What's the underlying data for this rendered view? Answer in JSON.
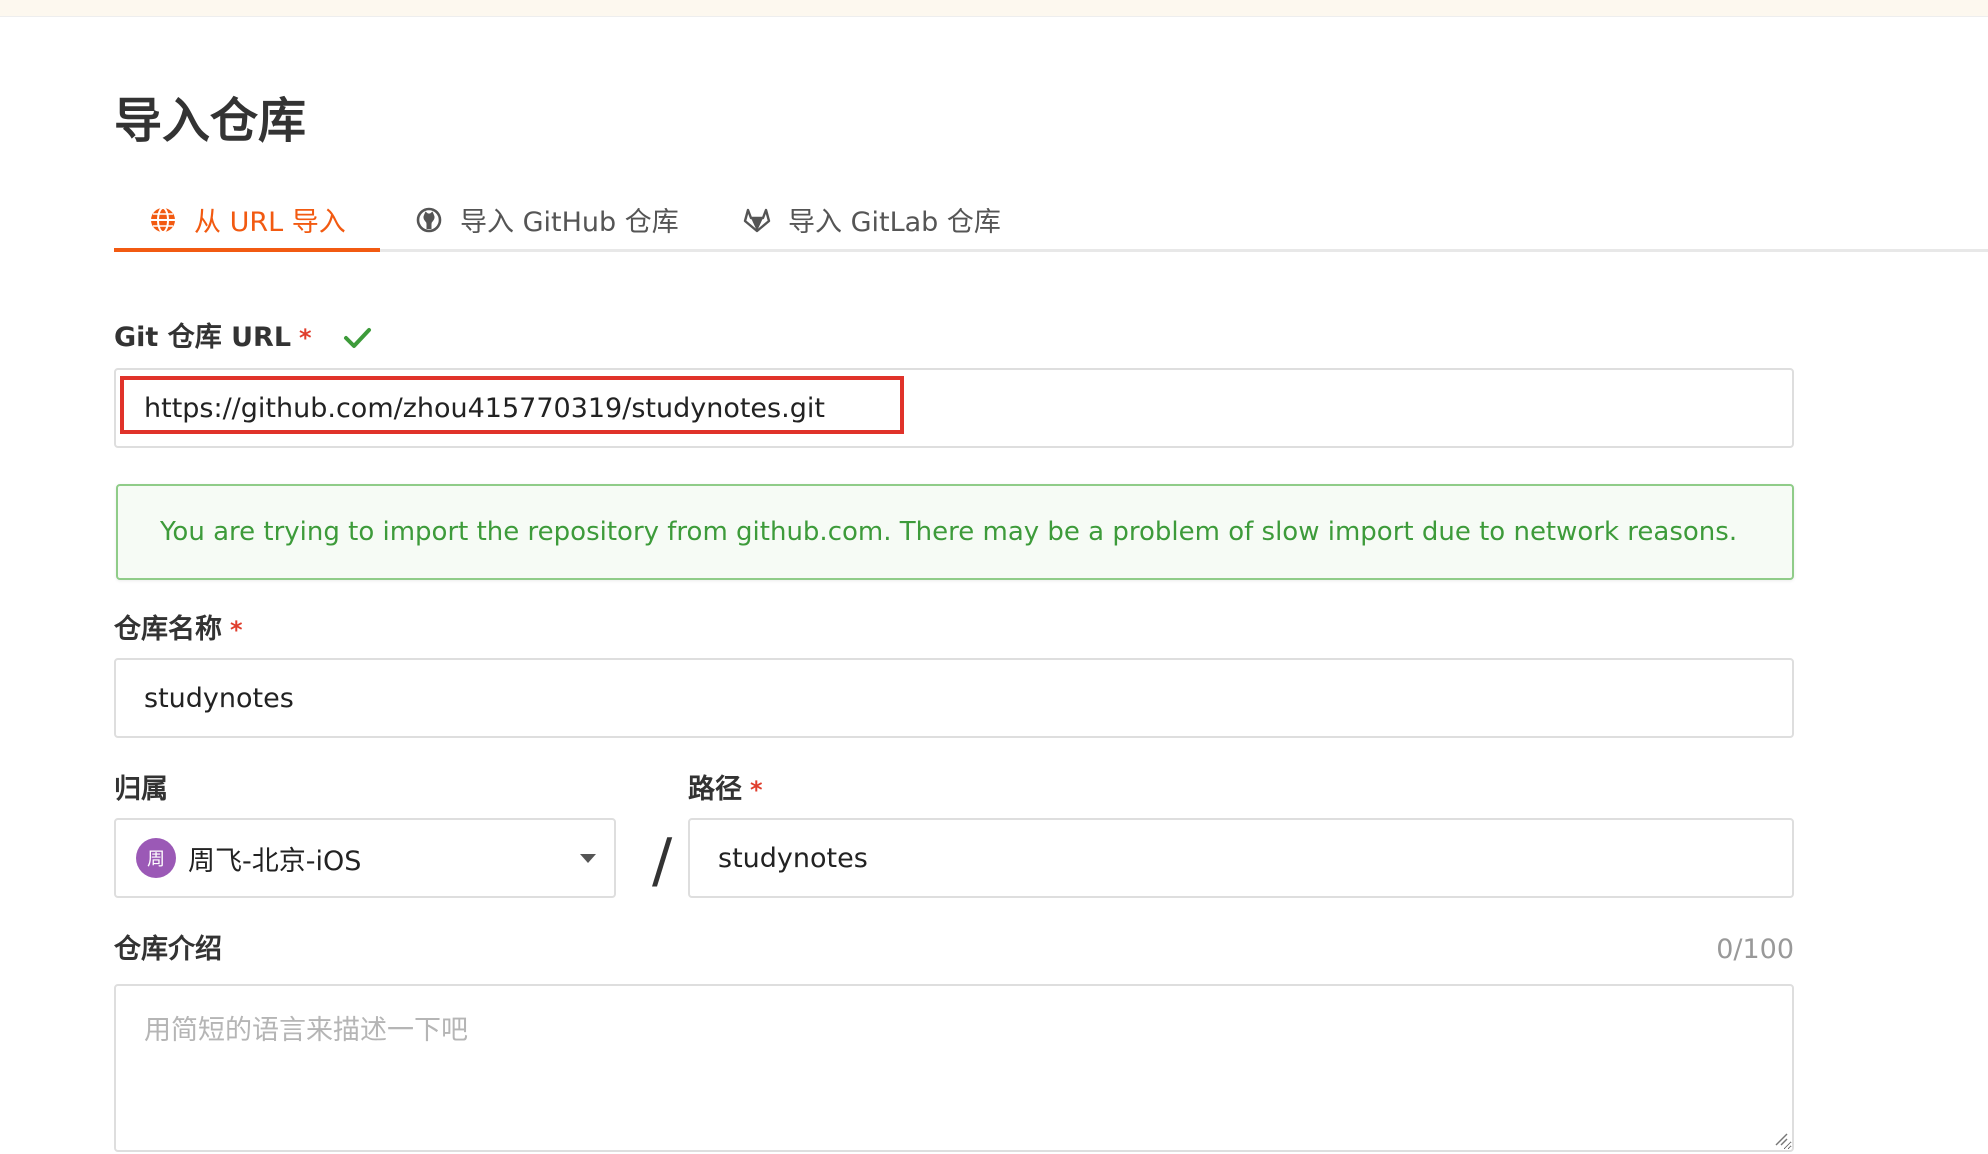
{
  "page": {
    "title": "导入仓库"
  },
  "tabs": [
    {
      "label": "从 URL 导入",
      "icon": "globe-icon",
      "active": true
    },
    {
      "label": "导入 GitHub 仓库",
      "icon": "github-icon",
      "active": false
    },
    {
      "label": "导入 GitLab 仓库",
      "icon": "gitlab-icon",
      "active": false
    }
  ],
  "form": {
    "git_url": {
      "label": "Git 仓库 URL",
      "required_mark": "*",
      "value": "https://github.com/zhou415770319/studynotes.git"
    },
    "alert": {
      "text": "You are trying to import the repository from github.com. There may be a problem of slow import due to network reasons."
    },
    "repo_name": {
      "label": "仓库名称",
      "required_mark": "*",
      "value": "studynotes"
    },
    "owner": {
      "label": "归属",
      "avatar_text": "周",
      "value": "周飞-北京-iOS"
    },
    "separator": "/",
    "path": {
      "label": "路径",
      "required_mark": "*",
      "value": "studynotes"
    },
    "description": {
      "label": "仓库介绍",
      "counter": "0/100",
      "placeholder": "用简短的语言来描述一下吧",
      "value": ""
    }
  },
  "colors": {
    "accent": "#f25a11",
    "required": "#e03e2d",
    "success": "#3d9b3a",
    "highlight_border": "#e0322a",
    "avatar_bg": "#9b59b6"
  }
}
